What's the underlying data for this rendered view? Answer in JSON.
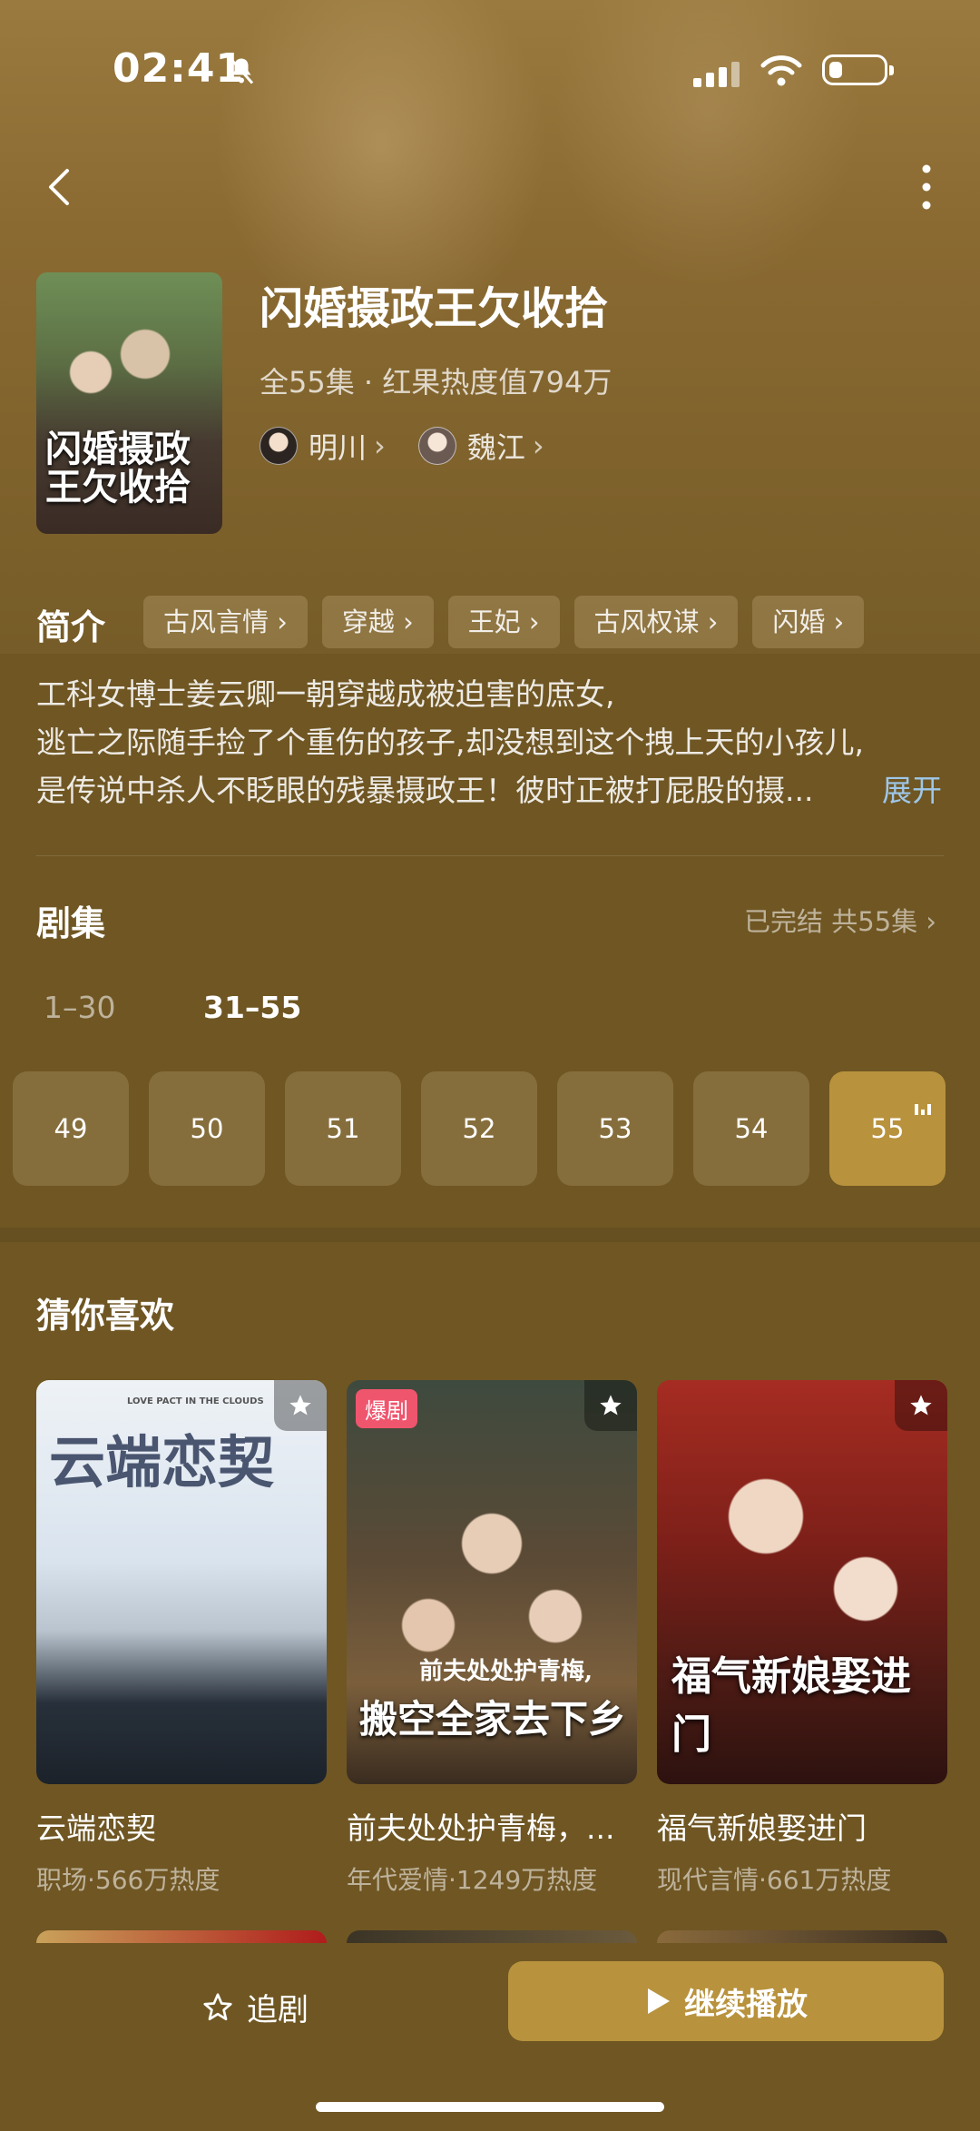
{
  "status_bar": {
    "time": "02:41"
  },
  "header": {
    "title": "闪婚摄政王欠收拾",
    "meta": "全55集 · 红果热度值794万",
    "cover_text": "闪婚摄政王欠收拾",
    "actors": [
      {
        "name": "明川"
      },
      {
        "name": "魏江"
      }
    ]
  },
  "intro": {
    "label": "简介",
    "tags": [
      "古风言情",
      "穿越",
      "王妃",
      "古风权谋",
      "闪婚"
    ],
    "lines": [
      "工科女博士姜云卿一朝穿越成被迫害的庶女,",
      "逃亡之际随手捡了个重伤的孩子,却没想到这个拽上天的小孩儿,",
      "是传说中杀人不眨眼的残暴摄政王！彼时正被打屁股的摄..."
    ],
    "expand": "展开"
  },
  "episodes": {
    "title": "剧集",
    "status": "已完结 共55集",
    "ranges": [
      "1–30",
      "31–55"
    ],
    "items": [
      "49",
      "50",
      "51",
      "52",
      "53",
      "54",
      "55"
    ],
    "active": "55"
  },
  "recommend": {
    "title": "猜你喜欢",
    "items": [
      {
        "name": "云端恋契",
        "meta": "职场·566万热度",
        "poster_text": "云端恋契",
        "poster_sub": "LOVE PACT IN THE CLOUDS"
      },
      {
        "name": "前夫处处护青梅，...",
        "meta": "年代爱情·1249万热度",
        "badge": "爆剧",
        "poster_text": "搬空全家去下乡",
        "poster_sub": "前夫处处护青梅,"
      },
      {
        "name": "福气新娘娶进门",
        "meta": "现代言情·661万热度",
        "poster_text": "福气新娘娶进门"
      }
    ]
  },
  "bottom_bar": {
    "follow": "追剧",
    "play": "继续播放"
  },
  "colors": {
    "accent": "#b8923d",
    "background": "#6f5623",
    "expand_link": "#9ec7e8",
    "badge": "#f0556e"
  }
}
